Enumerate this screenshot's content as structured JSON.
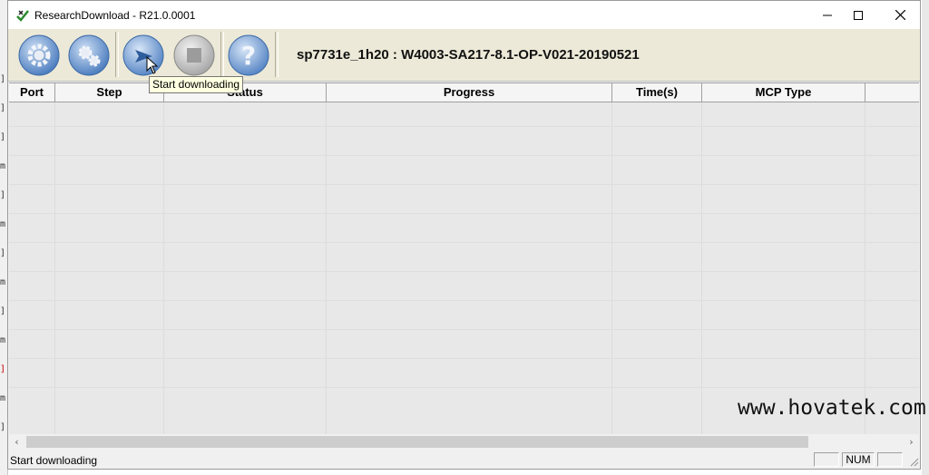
{
  "window": {
    "title": "ResearchDownload - R21.0.0001",
    "controls": {
      "minimize": "minimize-icon",
      "maximize": "maximize-icon",
      "close": "close-icon"
    }
  },
  "toolbar": {
    "buttons": [
      {
        "name": "load-packet-button",
        "icon": "gear-icon"
      },
      {
        "name": "settings-button",
        "icon": "gears-icon"
      },
      {
        "name": "start-download-button",
        "icon": "play-arrow-icon"
      },
      {
        "name": "stop-download-button",
        "icon": "stop-icon"
      },
      {
        "name": "help-button",
        "icon": "question-icon"
      }
    ],
    "firmware_title": "sp7731e_1h20 : W4003-SA217-8.1-OP-V021-20190521"
  },
  "tooltip": {
    "text": "Start downloading"
  },
  "table": {
    "columns": [
      "Port",
      "Step",
      "Status",
      "Progress",
      "Time(s)",
      "MCP Type"
    ],
    "rows": []
  },
  "statusbar": {
    "text": "Start downloading",
    "num_indicator": "NUM"
  },
  "watermark": "www.hovatek.com",
  "colors": {
    "toolbar_bg": "#ece9d8",
    "grid_bg": "#e8e8e8",
    "tooltip_bg": "#ffffe1",
    "button_blue": "#6f95cc"
  }
}
